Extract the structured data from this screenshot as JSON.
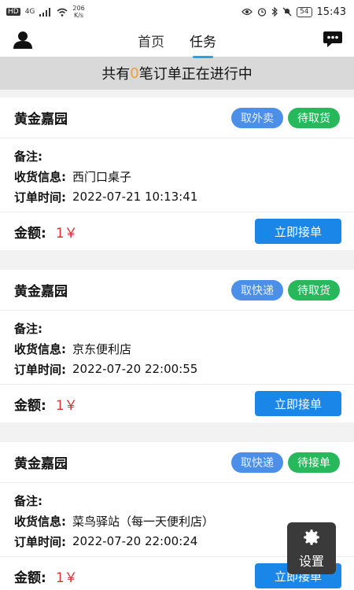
{
  "status_bar": {
    "hd": "HD",
    "signal": "4G",
    "speed_value": "206",
    "speed_unit": "K/s",
    "battery": "54",
    "time": "15:43"
  },
  "nav": {
    "tabs": [
      {
        "label": "首页",
        "active": false
      },
      {
        "label": "任务",
        "active": true
      }
    ]
  },
  "banner": {
    "prefix": "共有",
    "count": "0",
    "suffix": "笔订单正在进行中"
  },
  "labels": {
    "note": "备注:",
    "recipient": "收货信息:",
    "order_time": "订单时间:",
    "amount": "金额:",
    "accept": "立即接单"
  },
  "orders": [
    {
      "store": "黄金嘉园",
      "type_badge": "取外卖",
      "status_badge": "待取货",
      "note": "",
      "recipient": "西门口桌子",
      "time": "2022-07-21 10:13:41",
      "amount": "1￥"
    },
    {
      "store": "黄金嘉园",
      "type_badge": "取快递",
      "status_badge": "待取货",
      "note": "",
      "recipient": "京东便利店",
      "time": "2022-07-20 22:00:55",
      "amount": "1￥"
    },
    {
      "store": "黄金嘉园",
      "type_badge": "取快递",
      "status_badge": "待接单",
      "note": "",
      "recipient": "菜鸟驿站（每一天便利店）",
      "time": "2022-07-20 22:00:24",
      "amount": "1￥"
    }
  ],
  "fab": {
    "label": "设置"
  },
  "colors": {
    "accent": "#1a87e8",
    "badge_blue": "#4b8fe8",
    "badge_green": "#26b85a",
    "amount_red": "#d9332b",
    "count_orange": "#f0a030"
  },
  "icons": {
    "profile": "user-icon",
    "message": "chat-icon",
    "settings": "gear-icon"
  }
}
